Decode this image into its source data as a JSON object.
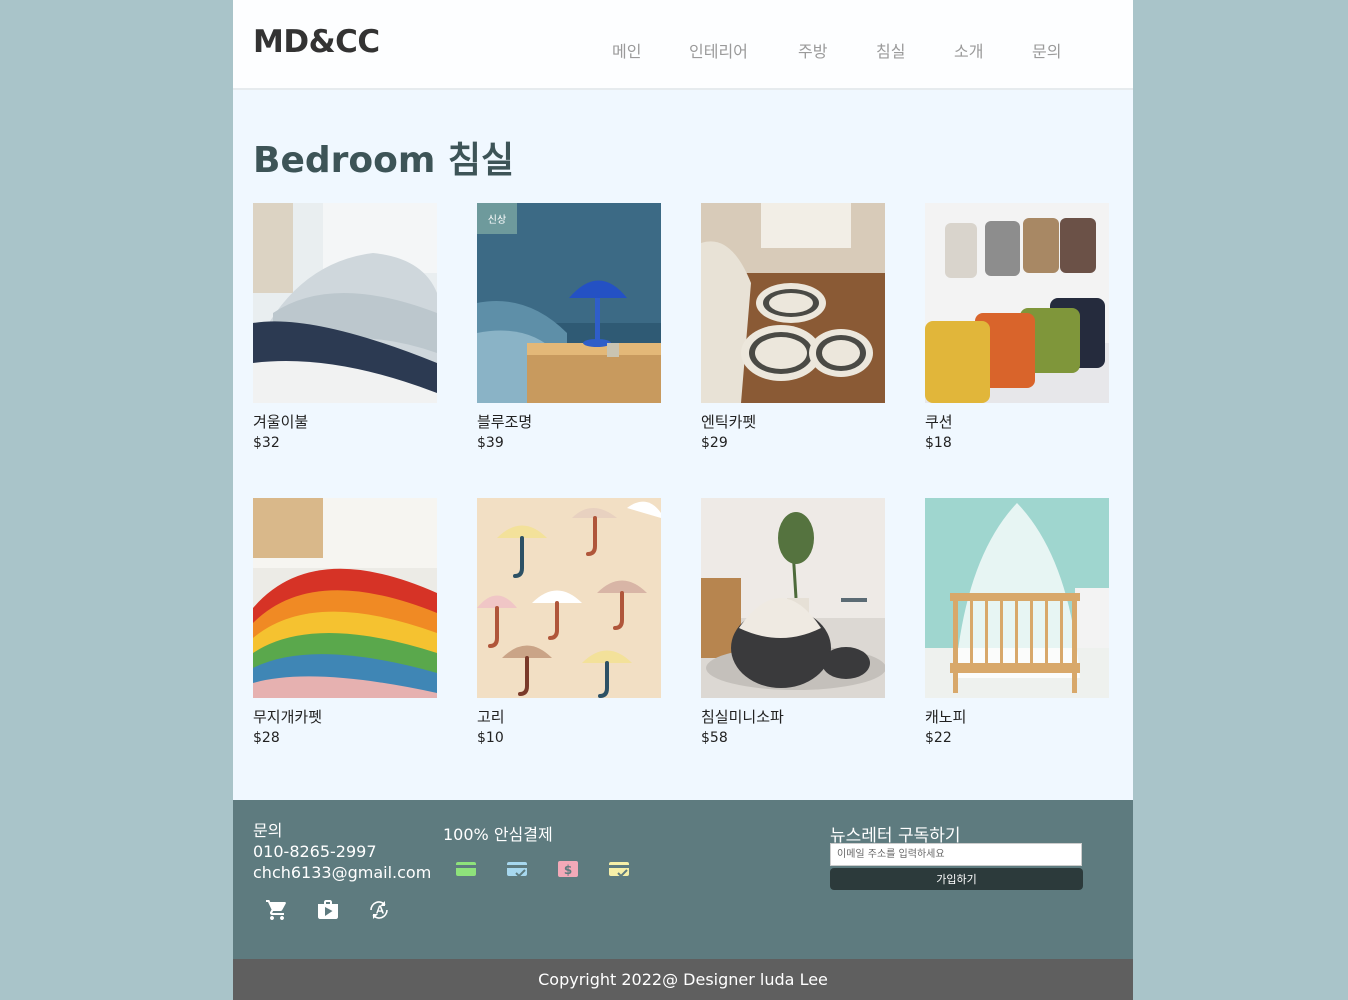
{
  "header": {
    "logo": "MD&CC",
    "nav": [
      "메인",
      "인테리어",
      "주방",
      "침실",
      "소개",
      "문의"
    ]
  },
  "main": {
    "title": "Bedroom 침실",
    "products": [
      {
        "name": "겨울이불",
        "price": "$32"
      },
      {
        "name": "블루조명",
        "price": "$39",
        "badge": "신상"
      },
      {
        "name": "엔틱카펫",
        "price": "$29"
      },
      {
        "name": "쿠션",
        "price": "$18"
      },
      {
        "name": "무지개카펫",
        "price": "$28"
      },
      {
        "name": "고리",
        "price": "$10"
      },
      {
        "name": "침실미니소파",
        "price": "$58"
      },
      {
        "name": "캐노피",
        "price": "$22"
      }
    ]
  },
  "footer": {
    "contact_title": "문의",
    "phone": "010-8265-2997",
    "email": "chch6133@gmail.com",
    "social_icons": [
      "cart-icon",
      "shop-bag-icon",
      "translate-icon"
    ],
    "payment_title": "100% 안심결제",
    "payment_icons": [
      "credit-card-icon",
      "card-check-icon",
      "dollar-icon",
      "card-verified-icon"
    ],
    "newsletter_title": "뉴스레터 구독하기",
    "newsletter_placeholder": "이메일 주소를 입력하세요",
    "newsletter_button": "가입하기",
    "copyright": "Copyright 2022@ Designer luda Lee"
  },
  "colors": {
    "background": "#a9c4c9",
    "page": "#f0f8ff",
    "footer": "#5e7b7f",
    "copyright_bar": "#5f5f5f",
    "title": "#3d5457",
    "badge": "#6e9a9c"
  }
}
